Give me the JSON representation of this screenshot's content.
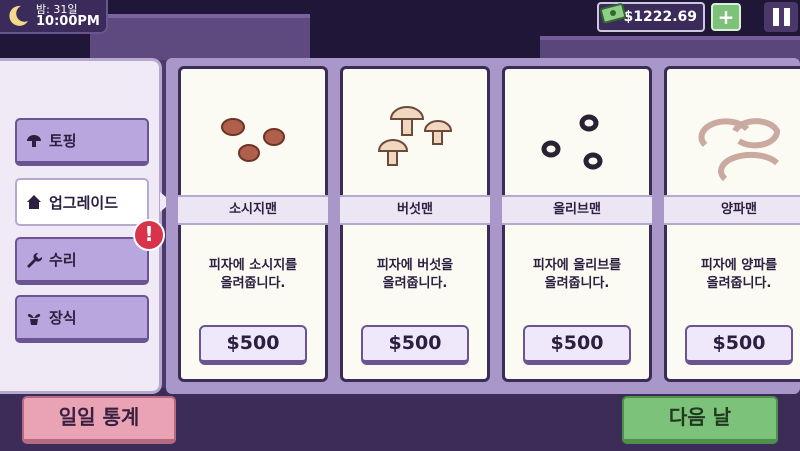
{
  "hud": {
    "day": "밤: 31일",
    "time": "10:00PM",
    "money": "$1222.69",
    "add_label": "+"
  },
  "menu": [
    {
      "label": "토핑",
      "icon": "mushroom-icon"
    },
    {
      "label": "업그레이드",
      "icon": "house-icon"
    },
    {
      "label": "수리",
      "icon": "wrench-icon"
    },
    {
      "label": "장식",
      "icon": "plant-icon"
    }
  ],
  "alert_label": "!",
  "cards": [
    {
      "name": "소시지맨",
      "desc_line1": "피자에 소시지를",
      "desc_line2": "올려줍니다.",
      "price": "$500",
      "art": "sausage-art"
    },
    {
      "name": "버섯맨",
      "desc_line1": "피자에 버섯을",
      "desc_line2": "올려줍니다.",
      "price": "$500",
      "art": "mushroom-art"
    },
    {
      "name": "올리브맨",
      "desc_line1": "피자에 올리브를",
      "desc_line2": "올려줍니다.",
      "price": "$500",
      "art": "olive-art"
    },
    {
      "name": "양파맨",
      "desc_line1": "피자에 양파를",
      "desc_line2": "올려줍니다.",
      "price": "$500",
      "art": "onion-art"
    }
  ],
  "bottom": {
    "stats_label": "일일 통계",
    "next_label": "다음 날"
  },
  "colors": {
    "panel": "#efeaf6",
    "menu_button": "#b9a6de",
    "stats_button": "#e9a3b5",
    "next_button": "#7dc27a",
    "alert": "#d8334a"
  }
}
